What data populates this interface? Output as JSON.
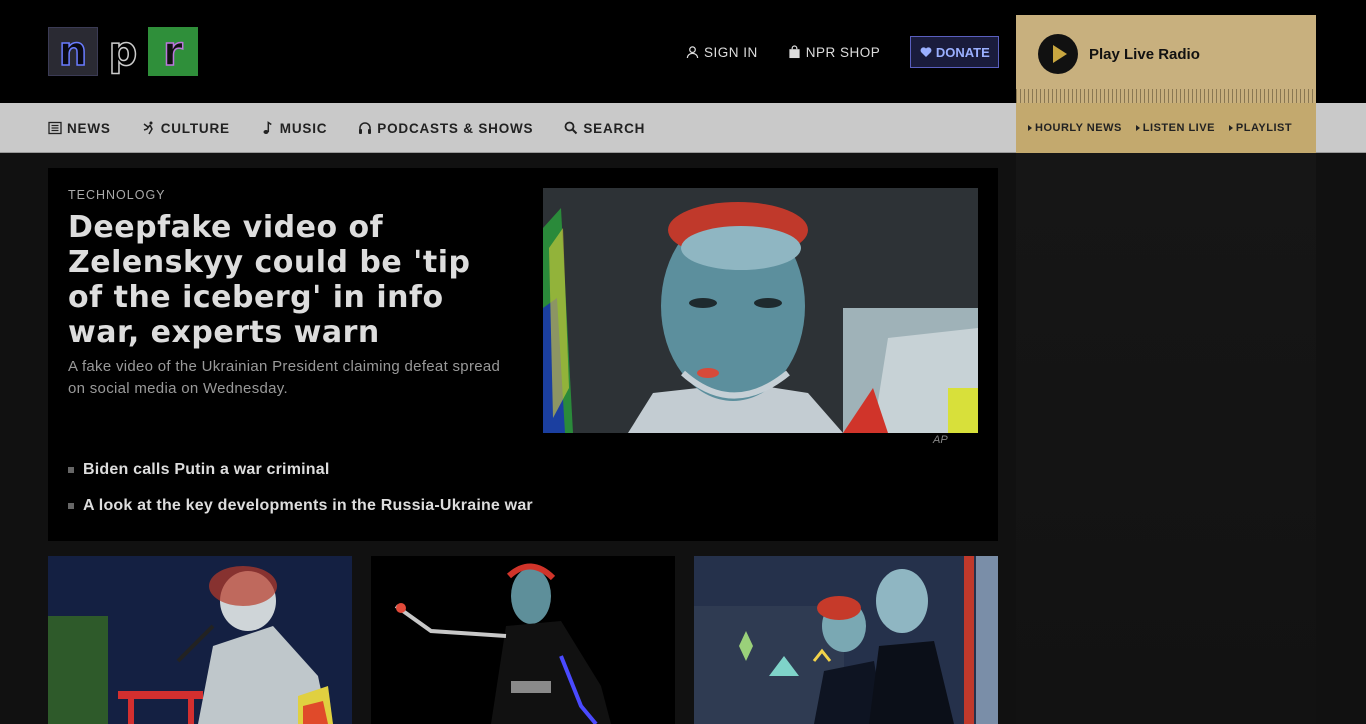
{
  "header": {
    "logo_letters": [
      "n",
      "p",
      "r"
    ],
    "sign_in": "SIGN IN",
    "shop": "NPR SHOP",
    "donate": "DONATE"
  },
  "nav": {
    "items": [
      {
        "label": "NEWS",
        "icon": "news-icon"
      },
      {
        "label": "CULTURE",
        "icon": "culture-icon"
      },
      {
        "label": "MUSIC",
        "icon": "music-note-icon"
      },
      {
        "label": "PODCASTS & SHOWS",
        "icon": "headphones-icon"
      },
      {
        "label": "SEARCH",
        "icon": "search-icon"
      }
    ]
  },
  "player": {
    "title": "Play Live Radio",
    "links": [
      "HOURLY NEWS",
      "LISTEN LIVE",
      "PLAYLIST"
    ],
    "accent": "#c8b07e"
  },
  "hero": {
    "slug": "TECHNOLOGY",
    "title": "Deepfake video of Zelenskyy could be 'tip of the iceberg' in info war, experts warn",
    "teaser": "A fake video of the Ukrainian President claiming defeat spread on social media on Wednesday.",
    "credit": "AP",
    "related": [
      "Biden calls Putin a war criminal",
      "A look at the key developments in the Russia-Ukraine war"
    ]
  },
  "cards": [
    {
      "image": "performer-photo"
    },
    {
      "image": "stage-photo"
    },
    {
      "image": "speakers-photo"
    }
  ]
}
